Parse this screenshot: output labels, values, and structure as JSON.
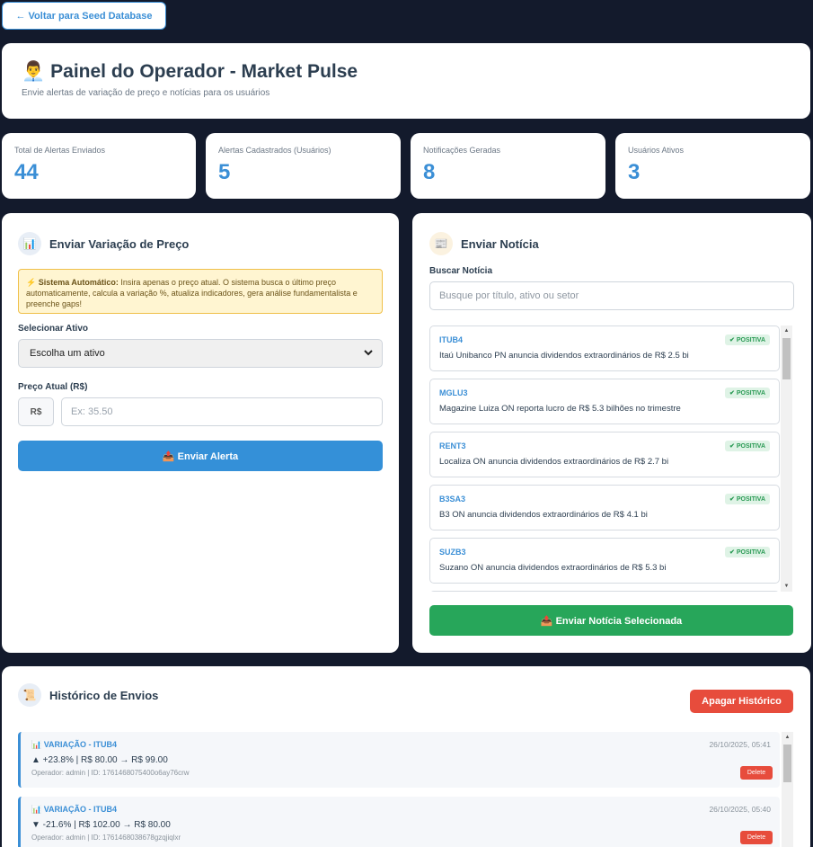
{
  "back_button": "← Voltar para Seed Database",
  "header": {
    "icon": "👨‍💼",
    "title": "Painel do Operador - Market Pulse",
    "subtitle": "Envie alertas de variação de preço e notícias para os usuários"
  },
  "stats": [
    {
      "label": "Total de Alertas Enviados",
      "value": "44"
    },
    {
      "label": "Alertas Cadastrados (Usuários)",
      "value": "5"
    },
    {
      "label": "Notificações Geradas",
      "value": "8"
    },
    {
      "label": "Usuários Ativos",
      "value": "3"
    }
  ],
  "price_panel": {
    "icon": "📊",
    "title": "Enviar Variação de Preço",
    "notice_bold": "⚡ Sistema Automático:",
    "notice_text": " Insira apenas o preço atual. O sistema busca o último preço automaticamente, calcula a variação %, atualiza indicadores, gera análise fundamentalista e preenche gaps!",
    "asset_label": "Selecionar Ativo",
    "asset_selected": "Escolha um ativo",
    "price_label": "Preço Atual (R$)",
    "currency": "R$",
    "price_placeholder": "Ex: 35.50",
    "send_button": "📤 Enviar Alerta"
  },
  "news_panel": {
    "icon": "📰",
    "title": "Enviar Notícia",
    "search_label": "Buscar Notícia",
    "search_placeholder": "Busque por título, ativo ou setor",
    "items": [
      {
        "ticker": "ITUB4",
        "badge": "✔ POSITIVA",
        "title": "Itaú Unibanco PN anuncia dividendos extraordinários de R$ 2.5 bi"
      },
      {
        "ticker": "MGLU3",
        "badge": "✔ POSITIVA",
        "title": "Magazine Luiza ON reporta lucro de R$ 5.3 bilhões no trimestre"
      },
      {
        "ticker": "RENT3",
        "badge": "✔ POSITIVA",
        "title": "Localiza ON anuncia dividendos extraordinários de R$ 2.7 bi"
      },
      {
        "ticker": "B3SA3",
        "badge": "✔ POSITIVA",
        "title": "B3 ON anuncia dividendos extraordinários de R$ 4.1 bi"
      },
      {
        "ticker": "SUZB3",
        "badge": "✔ POSITIVA",
        "title": "Suzano ON anuncia dividendos extraordinários de R$ 5.3 bi"
      }
    ],
    "send_button": "📤 Enviar Notícia Selecionada"
  },
  "history": {
    "icon": "📜",
    "title": "Histórico de Envios",
    "clear_button": "Apagar Histórico",
    "items": [
      {
        "type": "📊 VARIAÇÃO - ITUB4",
        "main": "▲ +23.8% | R$ 80.00 → R$ 99.00",
        "operator": "Operador: admin | ID: 1761468075400o6ay76crw",
        "date": "26/10/2025, 05:41",
        "delete": "Delete"
      },
      {
        "type": "📊 VARIAÇÃO - ITUB4",
        "main": "▼ -21.6% | R$ 102.00 → R$ 80.00",
        "operator": "Operador: admin | ID: 1761468038678gzqjiqlxr",
        "date": "26/10/2025, 05:40",
        "delete": "Delete"
      }
    ]
  },
  "colors": {
    "accent": "#3b8fd6",
    "success": "#27a65a",
    "danger": "#e74c3c",
    "background": "#131a2c"
  }
}
